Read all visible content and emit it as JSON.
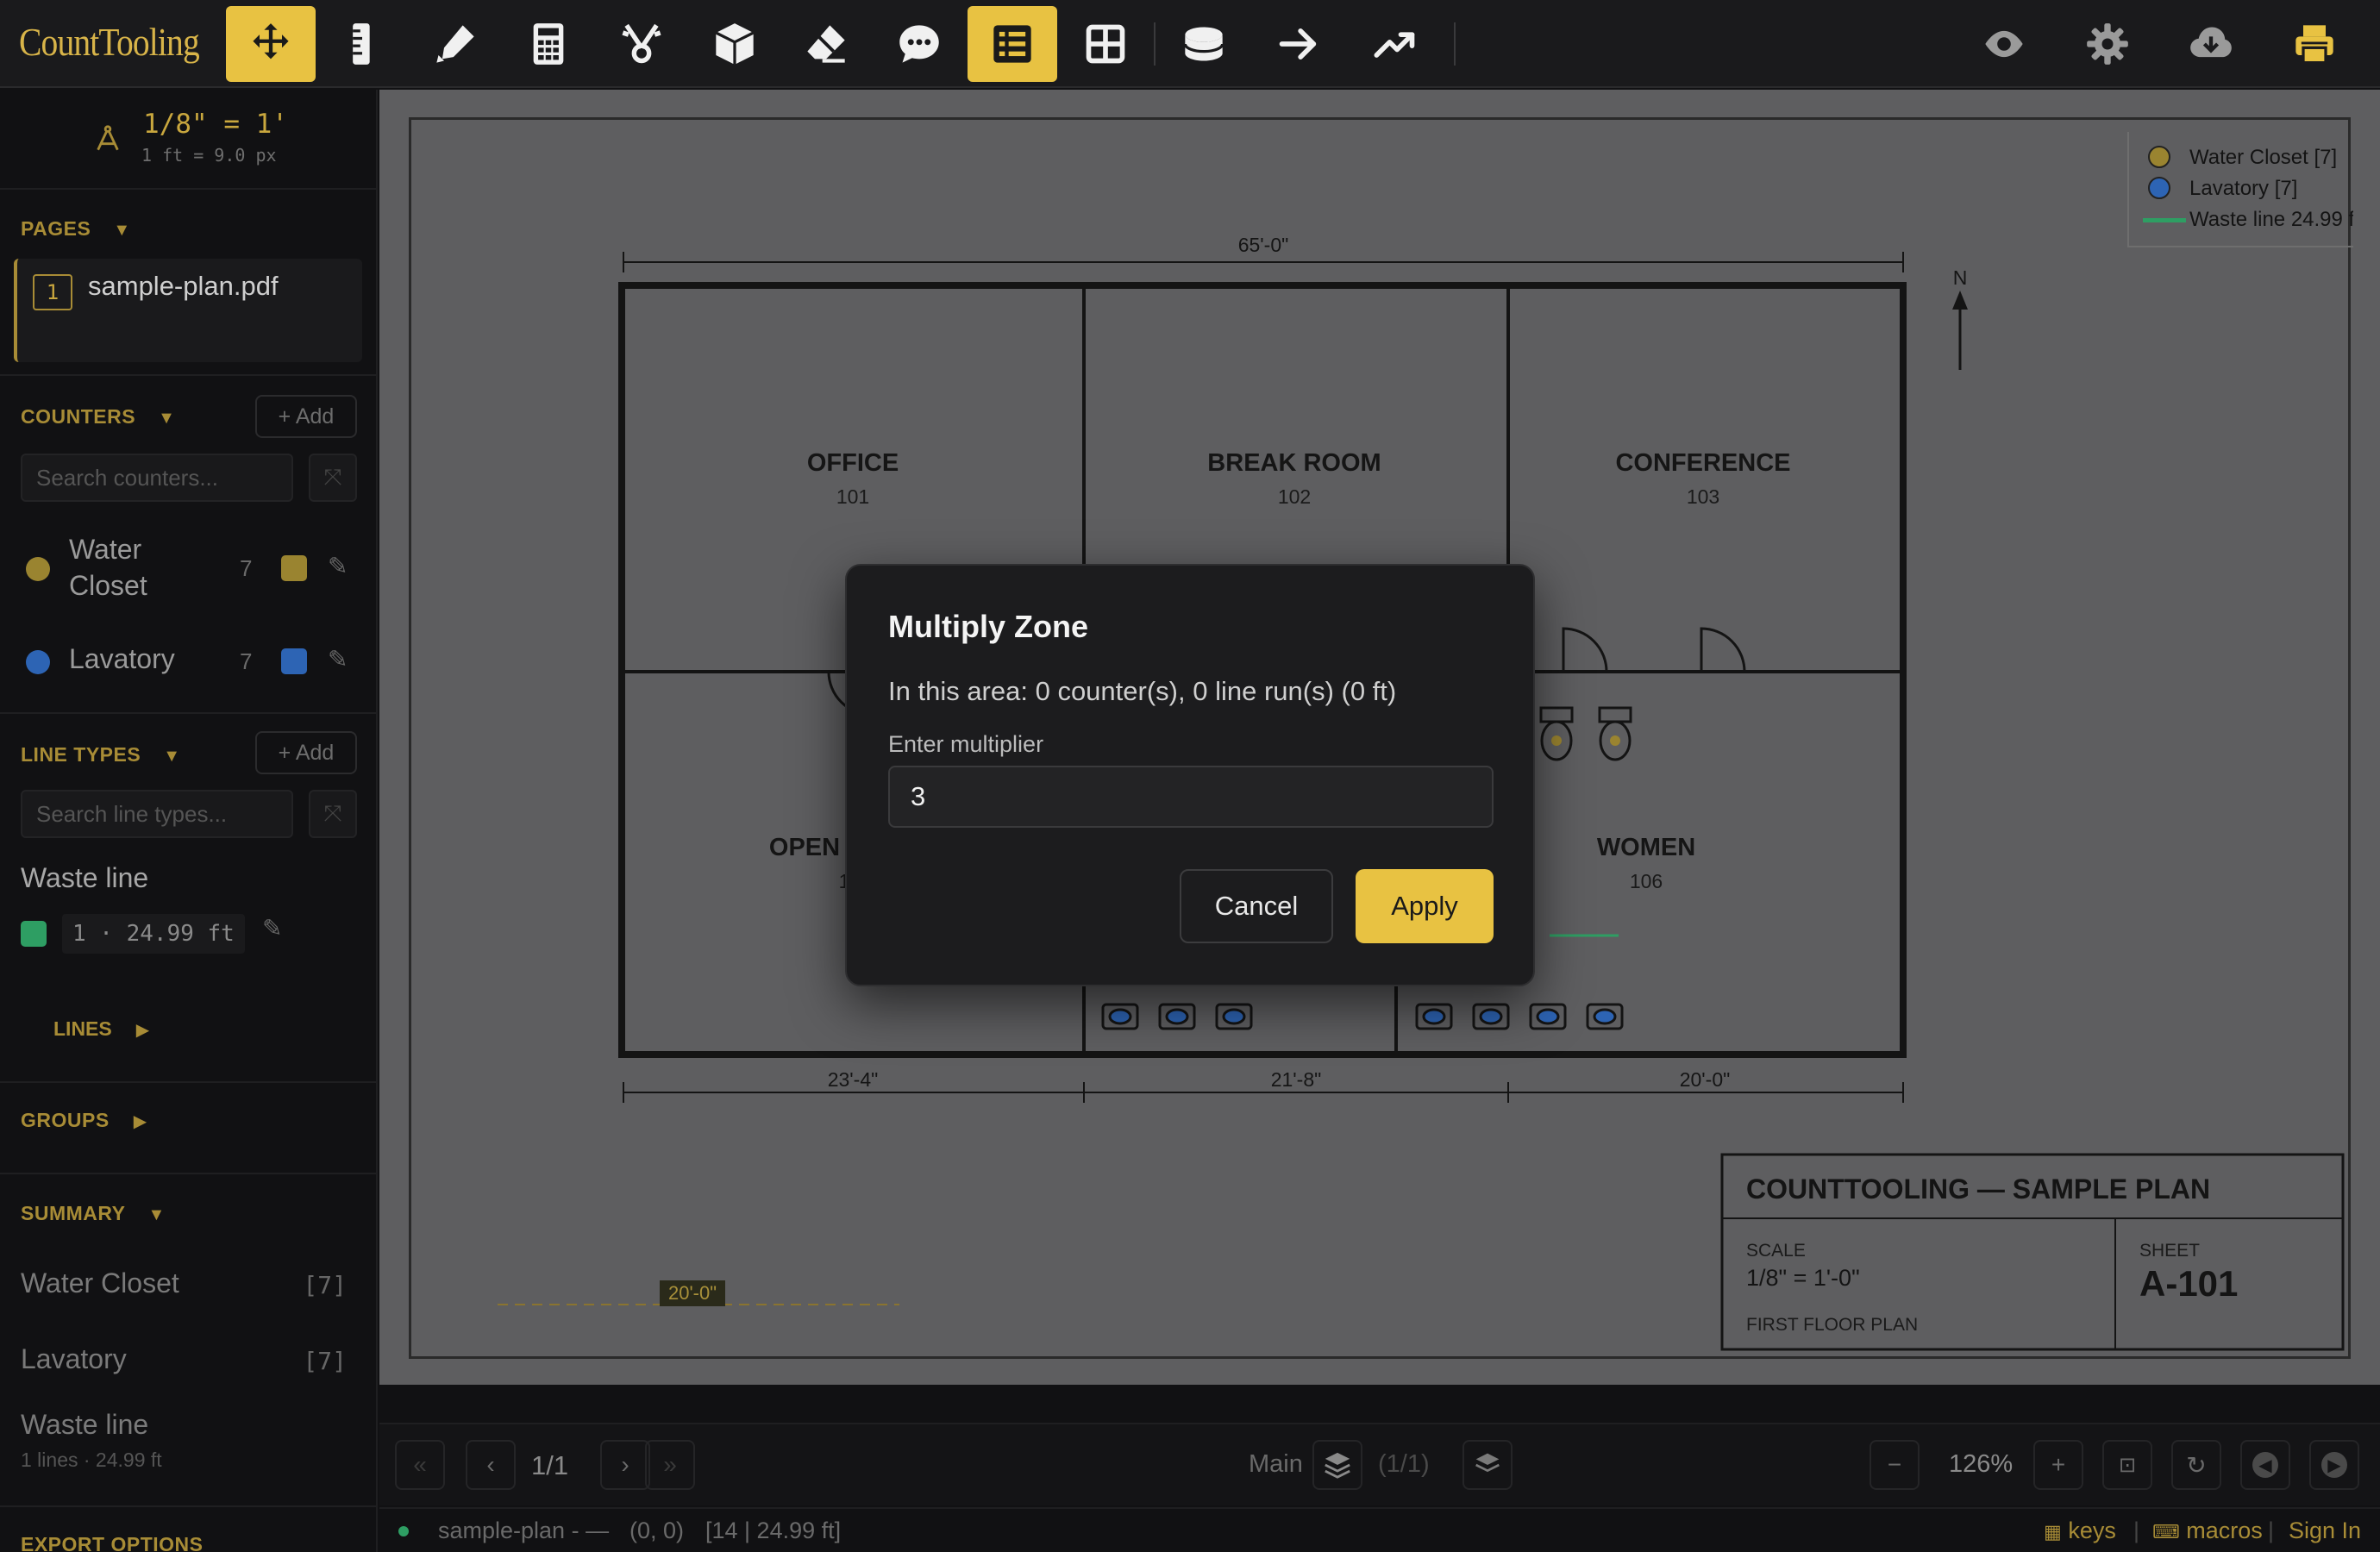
{
  "app": {
    "logo": "CountTooling"
  },
  "toolbar": {
    "tools": [
      "move-icon",
      "ruler-icon",
      "pen-icon",
      "calculator-icon",
      "cut-icon",
      "box-icon",
      "eraser-icon",
      "comment-icon",
      "list-icon",
      "grid-icon",
      "database-icon",
      "arrow-right-icon",
      "trending-icon"
    ],
    "active_tools": [
      "move-icon",
      "list-icon"
    ],
    "right_tools": [
      "eye-icon",
      "gear-icon",
      "cloud-download-icon",
      "printer-icon"
    ],
    "accent": "#e8c242"
  },
  "scale": {
    "ratio": "1/8\" = 1'",
    "px_per_ft": "1 ft = 9.0 px"
  },
  "sidebar": {
    "pages": {
      "title": "PAGES",
      "items": [
        {
          "number": "1",
          "name": "sample-plan.pdf"
        }
      ]
    },
    "counters": {
      "title": "COUNTERS",
      "add_label": "+ Add",
      "search_placeholder": "Search counters...",
      "items": [
        {
          "name_line1": "Water",
          "name_line2": "Closet",
          "count": "7",
          "color": "#9a8430"
        },
        {
          "name_line1": "Lavatory",
          "name_line2": "",
          "count": "7",
          "color": "#2d64b4"
        }
      ]
    },
    "line_types": {
      "title": "LINE TYPES",
      "add_label": "+ Add",
      "search_placeholder": "Search line types...",
      "items": [
        {
          "name": "Waste line",
          "detail": "1 · 24.99 ft",
          "color": "#2e9e63"
        }
      ],
      "lines_label": "LINES"
    },
    "groups": {
      "title": "GROUPS"
    },
    "summary": {
      "title": "SUMMARY",
      "rows": [
        {
          "name": "Water Closet",
          "badge": "[7]"
        },
        {
          "name": "Lavatory",
          "badge": "[7]"
        },
        {
          "name": "Waste line",
          "sub": "1 lines · 24.99 ft"
        }
      ]
    },
    "export": {
      "title": "EXPORT OPTIONS"
    }
  },
  "plan": {
    "north": "N",
    "overall_dim": "65'-0\"",
    "rooms": [
      {
        "name": "OFFICE",
        "number": "101"
      },
      {
        "name": "BREAK ROOM",
        "number": "102"
      },
      {
        "name": "CONFERENCE",
        "number": "103"
      },
      {
        "name": "OPEN",
        "number": "1"
      },
      {
        "name": "WOMEN",
        "number": "106"
      }
    ],
    "bottom_dims": [
      "23'-4\"",
      "21'-8\"",
      "20'-0\""
    ],
    "measure_label": "20'-0\"",
    "legend": [
      {
        "label": "Water Closet [7]",
        "color": "#9a8430"
      },
      {
        "label": "Lavatory [7]",
        "color": "#2d64b4"
      },
      {
        "label": "Waste line 24.99 f",
        "color": "#2e9e63"
      }
    ],
    "title_block": {
      "title": "COUNTTOOLING — SAMPLE PLAN",
      "scale_label": "SCALE",
      "scale_value": "1/8\" = 1'-0\"",
      "sheet_label": "SHEET",
      "sheet_value": "A-101",
      "floor": "FIRST FLOOR PLAN"
    }
  },
  "bottom": {
    "page_indicator": "1/1",
    "layer_name": "Main",
    "layer_count": "(1/1)",
    "zoom": "126%"
  },
  "status": {
    "file": "sample-plan - —",
    "coords": "(0, 0)",
    "info": "[14 | 24.99 ft]",
    "keys": "keys",
    "macros": "macros",
    "signin": "Sign In"
  },
  "modal": {
    "title": "Multiply Zone",
    "info": "In this area: 0 counter(s), 0 line run(s) (0 ft)",
    "label": "Enter multiplier",
    "value": "3",
    "cancel": "Cancel",
    "apply": "Apply"
  }
}
